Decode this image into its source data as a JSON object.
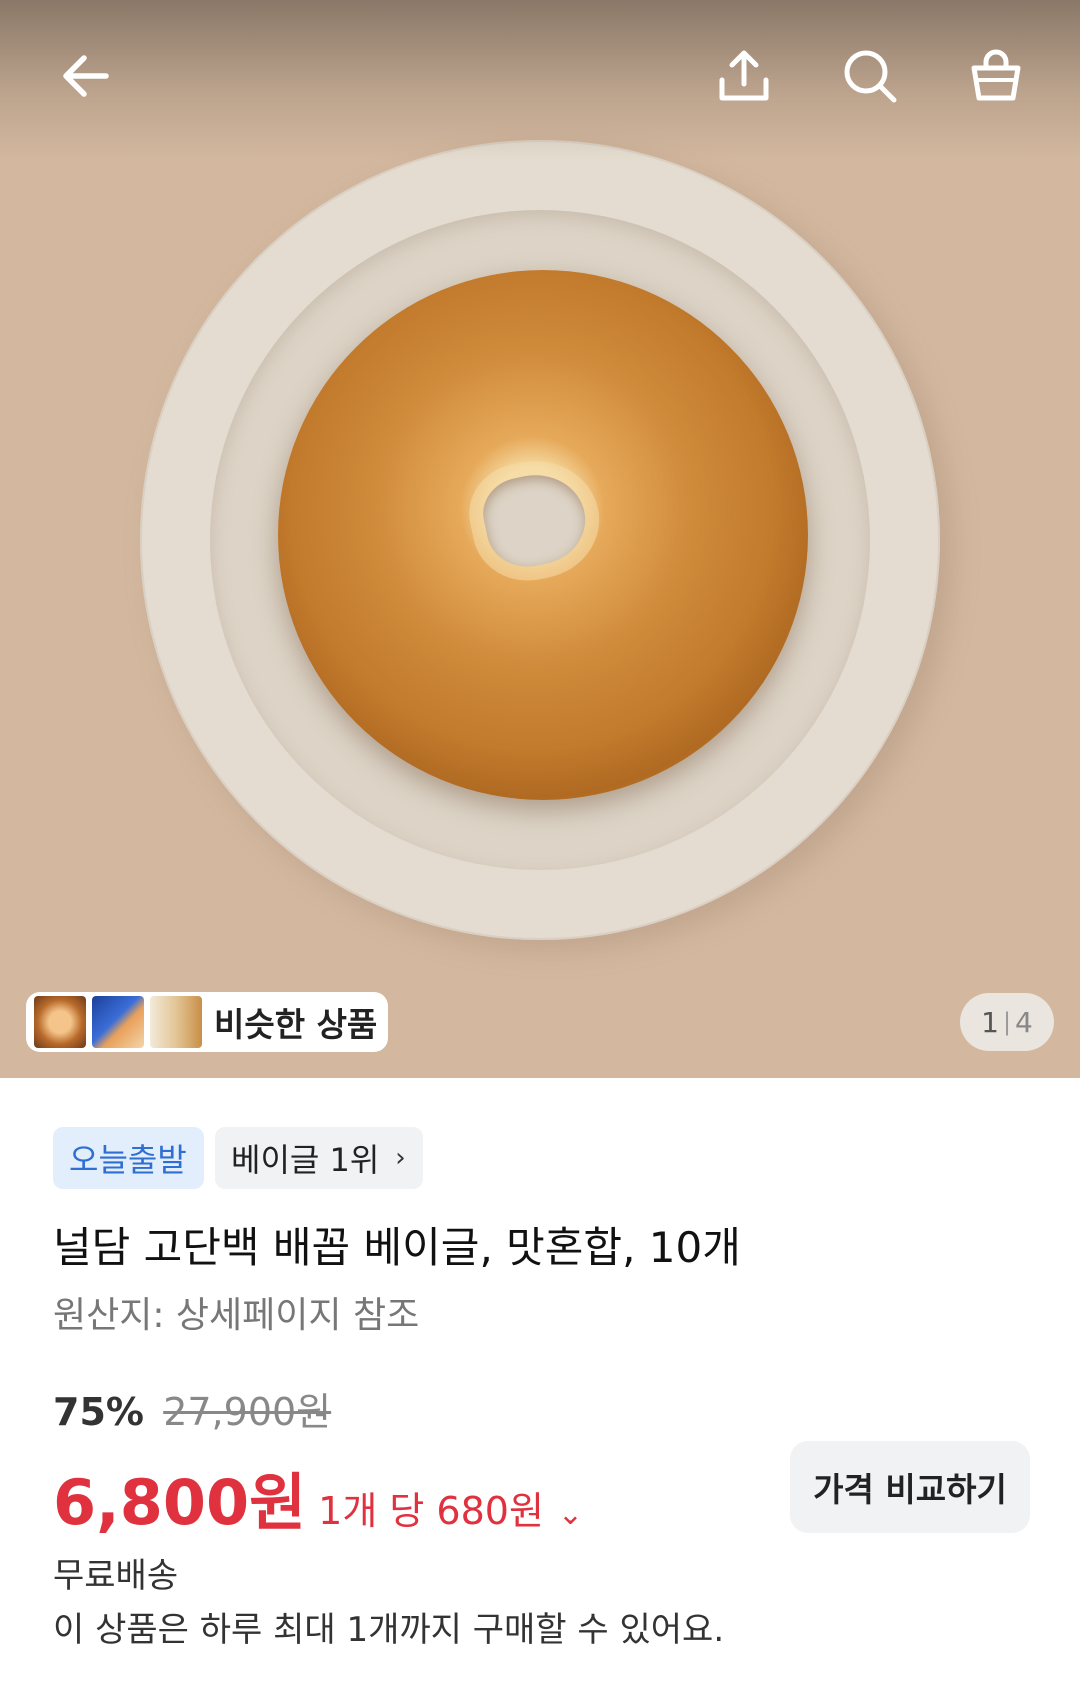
{
  "product_image": {
    "alt": "",
    "background_color": "#d3b89f"
  },
  "topbar": {
    "back_icon": "arrow-left-icon",
    "share_icon": "share-upload-icon",
    "search_icon": "search-icon",
    "cart_icon": "shopping-bag-icon"
  },
  "similar_products": {
    "label": "비슷한 상품"
  },
  "pager": {
    "current": "1",
    "separator": "|",
    "total": "4"
  },
  "tags": {
    "delivery": "오늘출발",
    "ranking": "베이글 1위",
    "ranking_chevron": "›"
  },
  "product": {
    "title": "널담 고단백 배꼽 베이글, 맛혼합, 10개",
    "origin": "원산지: 상세페이지 참조"
  },
  "pricing": {
    "discount": "75%",
    "original_price": "27,900원",
    "price": "6,800원",
    "unit_price": "1개 당 680원",
    "unit_chevron": "⌄",
    "compare_button": "가격 비교하기",
    "accent_color": "#e0313f"
  },
  "shipping": {
    "label": "무료배송",
    "purchase_limit": "이 상품은 하루 최대 1개까지 구매할 수 있어요."
  }
}
